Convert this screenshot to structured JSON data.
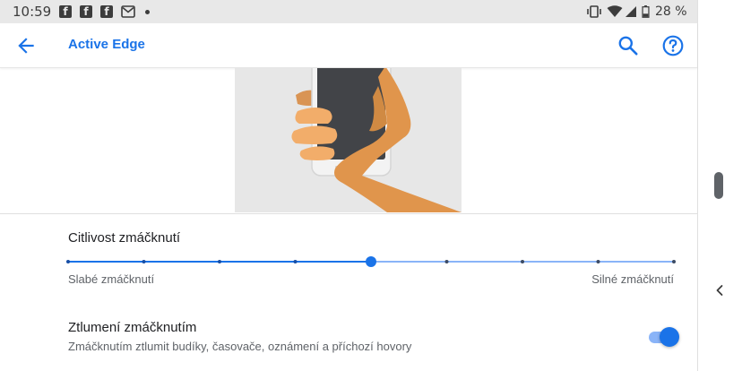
{
  "status_bar": {
    "time": "10:59",
    "notification_icons": [
      "facebook-icon",
      "facebook-icon",
      "facebook-icon",
      "gmail-icon",
      "more-dot-icon"
    ],
    "system_icons": [
      "vibrate-icon",
      "wifi-icon",
      "signal-icon",
      "battery-icon"
    ],
    "battery_percent": "28 %"
  },
  "toolbar": {
    "title": "Active Edge",
    "back_icon": "arrow-back-icon",
    "search_icon": "search-icon",
    "help_icon": "help-icon"
  },
  "sensitivity": {
    "title": "Citlivost zmáčknutí",
    "min_label": "Slabé zmáčknutí",
    "max_label": "Silné zmáčknutí",
    "steps": 9,
    "value_index": 4
  },
  "mute": {
    "title": "Ztlumení zmáčknutím",
    "subtitle": "Zmáčknutím ztlumit budíky, časovače, oznámení a příchozí hovory",
    "enabled": true
  },
  "colors": {
    "accent": "#1a73e8",
    "accent_light": "#8ab4f8"
  }
}
